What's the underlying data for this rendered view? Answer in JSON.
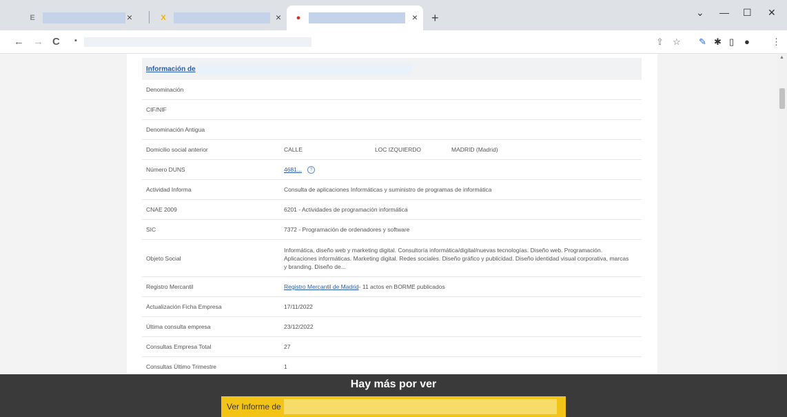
{
  "browser": {
    "tabs": [
      {
        "favicon": "E",
        "favicon_color": "#888888",
        "active": false
      },
      {
        "favicon": "X",
        "favicon_color": "#f2b200",
        "active": false
      },
      {
        "favicon": "●",
        "favicon_color": "#d93025",
        "active": true
      }
    ],
    "close_glyph": "×",
    "new_tab_glyph": "+",
    "window_controls": {
      "dropdown": "⌄",
      "minimize": "—",
      "maximize": "☐",
      "close": "✕"
    },
    "nav": {
      "back": "←",
      "forward": "→",
      "reload": "C"
    },
    "lock_glyph": "🔒",
    "ext_icons": [
      "share-icon",
      "star-icon",
      "pen-icon",
      "puzzle-icon",
      "sidebar-icon",
      "avatar-icon",
      "menu-icon"
    ]
  },
  "section_title": "Información de",
  "rows": [
    {
      "label": "Denominación",
      "value": ""
    },
    {
      "label": "CIF/NIF",
      "value": ""
    },
    {
      "label": "Denominación Antigua",
      "value": ""
    },
    {
      "label": "Domicilio social anterior",
      "parts": [
        "CALLE",
        "LOC IZQUIERDO",
        "MADRID (Madrid)"
      ]
    },
    {
      "label": "Número DUNS",
      "link": "4681...",
      "help": "?"
    },
    {
      "label": "Actividad Informa",
      "value": "Consulta de aplicaciones Informáticas y suministro de programas de informática"
    },
    {
      "label": "CNAE 2009",
      "value": "6201 - Actividades de programación informática"
    },
    {
      "label": "SIC",
      "value": "7372 - Programación de ordenadores y software"
    },
    {
      "label": "Objeto Social",
      "value": "Informática, diseño web y marketing digital. Consultoría informática/digital/nuevas tecnologías. Diseño web. Programación. Aplicaciones informáticas. Marketing digital. Redes sociales. Diseño gráfico y publicidad. Diseño identidad visual corporativa, marcas y branding. Diseño de..."
    },
    {
      "label": "Registro Mercantil",
      "link": "Registro Mercantil de Madrid",
      "suffix": " - 11 actos en BORME publicados"
    },
    {
      "label": "Actualización Ficha Empresa",
      "value": "17/11/2022"
    },
    {
      "label": "Última consulta empresa",
      "value": "23/12/2022"
    },
    {
      "label": "Consultas Empresa Total",
      "value": "27"
    },
    {
      "label": "Consultas Último Trimestre",
      "value": "1"
    }
  ],
  "overlay": {
    "heading": "Hay más por ver",
    "cta_label": "Ver Informe de"
  }
}
